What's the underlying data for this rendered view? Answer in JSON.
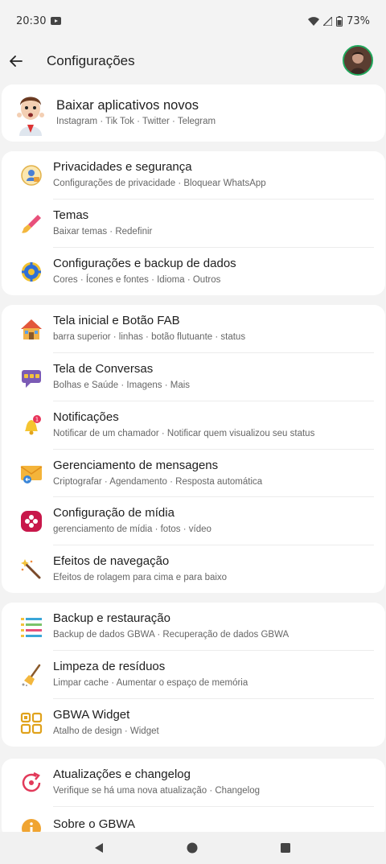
{
  "status": {
    "time": "20:30",
    "battery": "73%"
  },
  "appbar": {
    "title": "Configurações"
  },
  "promo": {
    "title": "Baixar aplicativos novos",
    "subtitle": "Instagram · Tik Tok · Twitter · Telegram"
  },
  "group1": [
    {
      "title": "Privacidades e segurança",
      "subtitle": "Configurações de privacidade · Bloquear WhatsApp",
      "icon": "privacy-icon"
    },
    {
      "title": "Temas",
      "subtitle": "Baixar temas · Redefinir",
      "icon": "paint-brush-icon"
    },
    {
      "title": "Configurações e backup de dados",
      "subtitle": "Cores · Ícones e fontes · Idioma · Outros",
      "icon": "gear-icon"
    }
  ],
  "group2": [
    {
      "title": "Tela inicial e Botão FAB",
      "subtitle": "barra superior · linhas · botão flutuante · status",
      "icon": "home-icon"
    },
    {
      "title": "Tela de Conversas",
      "subtitle": "Bolhas e Saúde · Imagens · Mais",
      "icon": "chat-bubble-icon"
    },
    {
      "title": "Notificações",
      "subtitle": "Notificar de um chamador · Notificar quem visualizou seu status",
      "icon": "bell-icon",
      "badge": "1"
    },
    {
      "title": "Gerenciamento de mensagens",
      "subtitle": "Criptografar · Agendamento · Resposta automática",
      "icon": "envelope-icon"
    },
    {
      "title": "Configuração de mídia",
      "subtitle": "gerenciamento de mídia · fotos · vídeo",
      "icon": "media-flower-icon"
    },
    {
      "title": "Efeitos de navegação",
      "subtitle": "Efeitos de rolagem para cima e para baixo",
      "icon": "magic-wand-icon"
    }
  ],
  "group3": [
    {
      "title": "Backup e restauração",
      "subtitle": "Backup de dados GBWA · Recuperação de dados GBWA",
      "icon": "list-icon"
    },
    {
      "title": "Limpeza de resíduos",
      "subtitle": "Limpar cache · Aumentar o espaço de memória",
      "icon": "broom-icon"
    },
    {
      "title": "GBWA Widget",
      "subtitle": "Atalho de design · Widget",
      "icon": "widget-icon"
    }
  ],
  "group4": [
    {
      "title": "Atualizações e changelog",
      "subtitle": "Verifique se há uma nova atualização · Changelog",
      "icon": "update-icon"
    },
    {
      "title": "Sobre o GBWA",
      "subtitle": "",
      "icon": "info-icon"
    }
  ],
  "colors": {
    "accent": "#1fa85c",
    "background": "#f3f3f3",
    "card": "#ffffff"
  }
}
